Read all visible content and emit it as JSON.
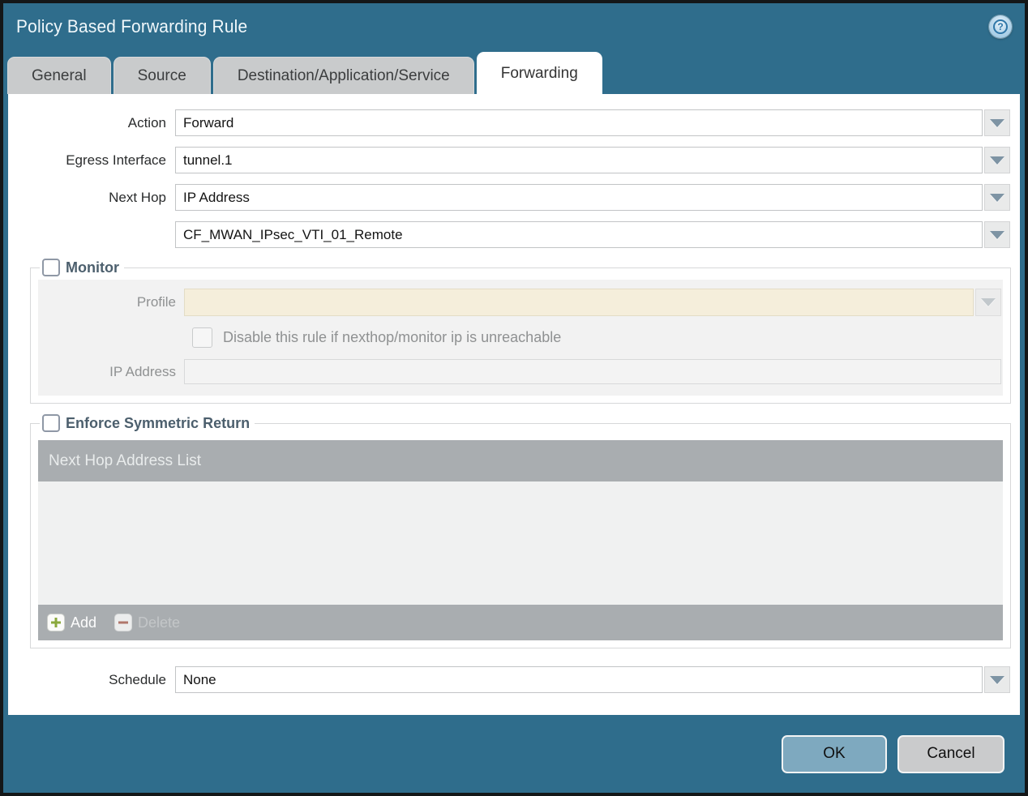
{
  "dialog": {
    "title": "Policy Based Forwarding Rule",
    "help_glyph": "?"
  },
  "tabs": [
    {
      "label": "General",
      "active": false
    },
    {
      "label": "Source",
      "active": false
    },
    {
      "label": "Destination/Application/Service",
      "active": false
    },
    {
      "label": "Forwarding",
      "active": true
    }
  ],
  "form": {
    "action": {
      "label": "Action",
      "value": "Forward"
    },
    "egress_interface": {
      "label": "Egress Interface",
      "value": "tunnel.1"
    },
    "next_hop": {
      "label": "Next Hop",
      "value": "IP Address"
    },
    "next_hop_address": {
      "value": "CF_MWAN_IPsec_VTI_01_Remote"
    },
    "schedule": {
      "label": "Schedule",
      "value": "None"
    }
  },
  "monitor": {
    "legend": "Monitor",
    "checked": false,
    "profile": {
      "label": "Profile",
      "value": ""
    },
    "disable_rule_label": "Disable this rule if nexthop/monitor ip is unreachable",
    "disable_rule_checked": false,
    "ip_address": {
      "label": "IP Address",
      "value": ""
    }
  },
  "symmetric_return": {
    "legend": "Enforce Symmetric Return",
    "checked": false,
    "table_header": "Next Hop Address List",
    "rows": [],
    "add_label": "Add",
    "delete_label": "Delete",
    "delete_enabled": false
  },
  "footer": {
    "ok_label": "OK",
    "cancel_label": "Cancel"
  },
  "colors": {
    "titlebar_teal": "#2f6d8c",
    "window_border": "#141718",
    "tab_gray": "#c9cbcc",
    "active_tab": "#ffffff",
    "legend_text": "#4c5f6d",
    "panel_gray": "#f2f2f2",
    "disabled_field_cream": "#f5eedb",
    "table_bar_gray": "#a9adb0",
    "table_body_gray": "#f0f1f1",
    "add_plus_green": "#8aa83c",
    "delete_minus_red": "#b0766b",
    "ok_button_blue": "#7ea9bf",
    "cancel_button_gray": "#cacbcc",
    "dropdown_arrow": "#7e94a4"
  }
}
